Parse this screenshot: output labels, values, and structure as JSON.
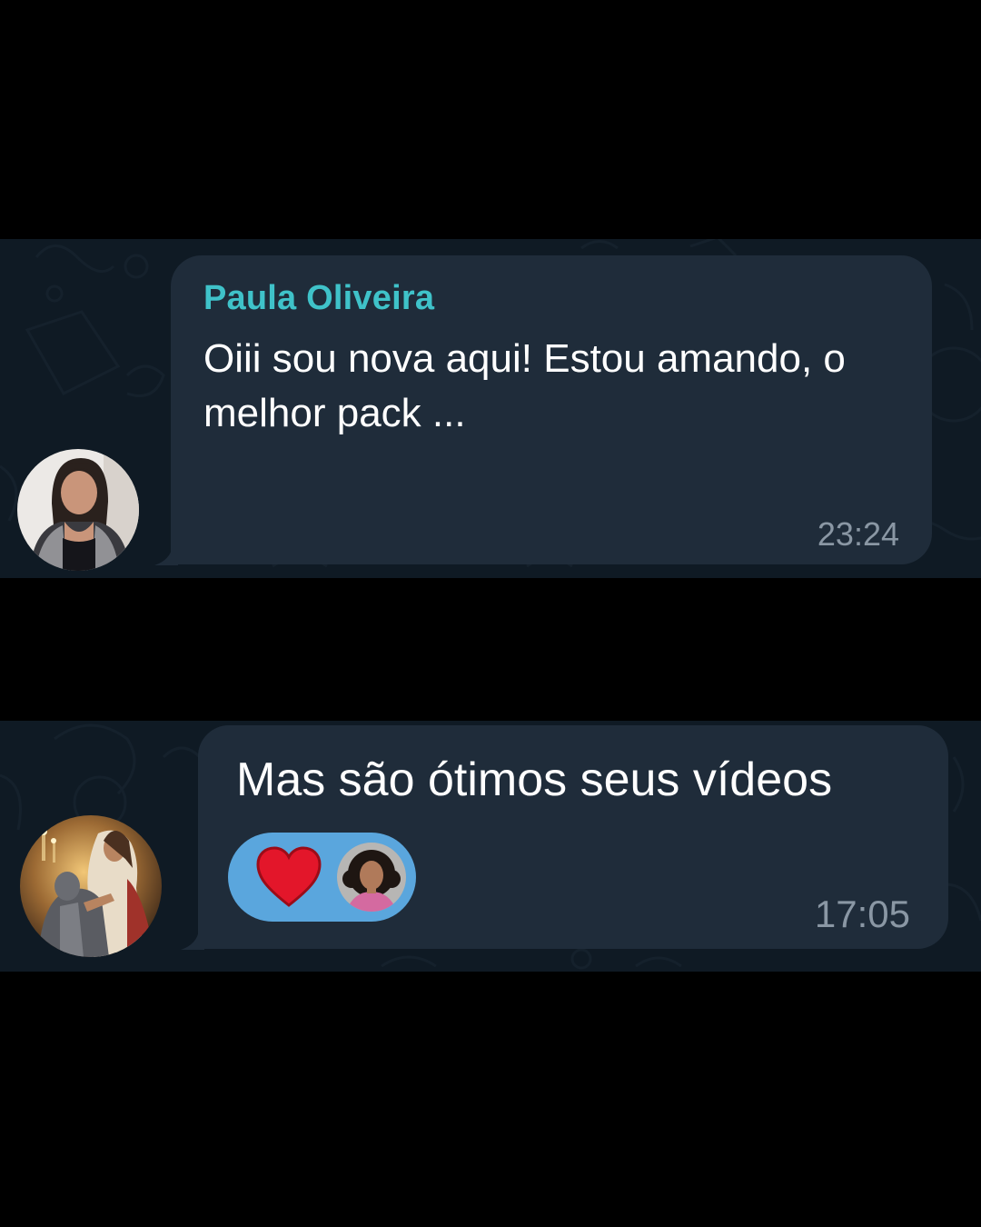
{
  "messages": [
    {
      "sender": "Paula Oliveira",
      "text": "Oiii sou nova aqui! Estou amando, o melhor pack ...",
      "time": "23:24",
      "avatar": "woman-portrait-avatar"
    },
    {
      "text": "Mas são ótimos seus vídeos",
      "time": "17:05",
      "avatar": "knight-painting-avatar",
      "reaction": {
        "emoji": "heart-icon",
        "reactor_avatar": "curly-hair-woman-avatar"
      }
    }
  ],
  "colors": {
    "page_background": "#000000",
    "chat_background": "#0f1a24",
    "bubble": "#1f2c3a",
    "sender_name": "#3fc2c9",
    "message_text": "#ffffff",
    "timestamp": "#8a97a4",
    "reaction_pill": "#5aa6dd",
    "heart": "#e3162a"
  }
}
